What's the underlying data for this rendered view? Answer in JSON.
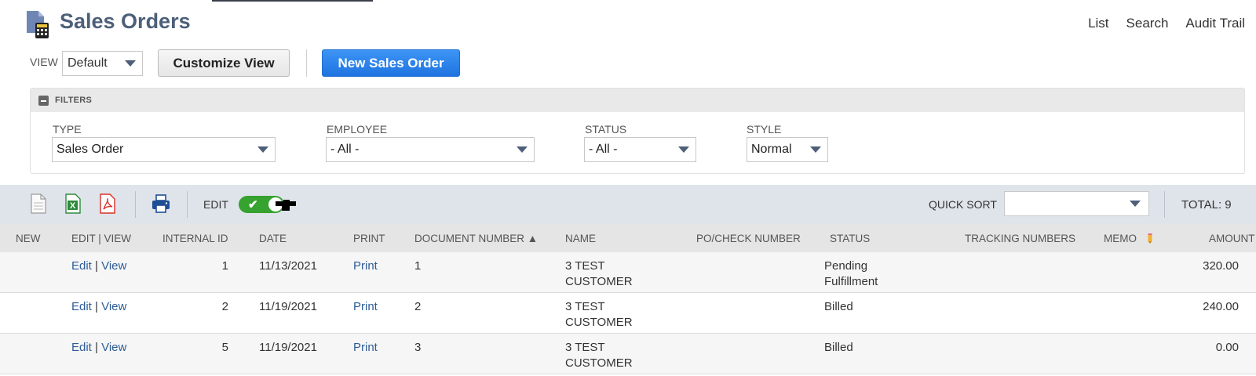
{
  "header": {
    "title": "Sales Orders",
    "links": [
      "List",
      "Search",
      "Audit Trail"
    ]
  },
  "view": {
    "label": "VIEW",
    "selected": "Default",
    "customize_label": "Customize View",
    "new_label": "New Sales Order"
  },
  "filters": {
    "title": "FILTERS",
    "type_label": "TYPE",
    "type_value": "Sales Order",
    "employee_label": "EMPLOYEE",
    "employee_value": "- All -",
    "status_label": "STATUS",
    "status_value": "- All -",
    "style_label": "STYLE",
    "style_value": "Normal"
  },
  "toolbar": {
    "edit_label": "EDIT",
    "edit_toggle_on": true,
    "quick_sort_label": "QUICK SORT",
    "quick_sort_value": "",
    "total": "TOTAL: 9"
  },
  "table": {
    "columns": [
      "NEW",
      "EDIT | VIEW",
      "INTERNAL ID",
      "DATE",
      "PRINT",
      "DOCUMENT NUMBER ▲",
      "NAME",
      "PO/CHECK NUMBER",
      "STATUS",
      "TRACKING NUMBERS",
      "MEMO",
      "AMOUNT"
    ],
    "rows": [
      {
        "edit": "Edit",
        "view": "View",
        "internal_id": "1",
        "date": "11/13/2021",
        "print": "Print",
        "doc_number": "1",
        "name_line1": "3 TEST",
        "name_line2": "CUSTOMER",
        "status_line1": "Pending",
        "status_line2": "Fulfillment",
        "amount": "320.00"
      },
      {
        "edit": "Edit",
        "view": "View",
        "internal_id": "2",
        "date": "11/19/2021",
        "print": "Print",
        "doc_number": "2",
        "name_line1": "3 TEST",
        "name_line2": "CUSTOMER",
        "status_line1": "Billed",
        "status_line2": "",
        "amount": "240.00"
      },
      {
        "edit": "Edit",
        "view": "View",
        "internal_id": "5",
        "date": "11/19/2021",
        "print": "Print",
        "doc_number": "3",
        "name_line1": "3 TEST",
        "name_line2": "CUSTOMER",
        "status_line1": "Billed",
        "status_line2": "",
        "amount": "0.00"
      }
    ]
  },
  "colors": {
    "title": "#4d5f79",
    "link": "#2d5c97",
    "primary_button": "#1f73e0",
    "toggle_on": "#36a22f",
    "toolbar_bg": "#dfe4eb"
  }
}
